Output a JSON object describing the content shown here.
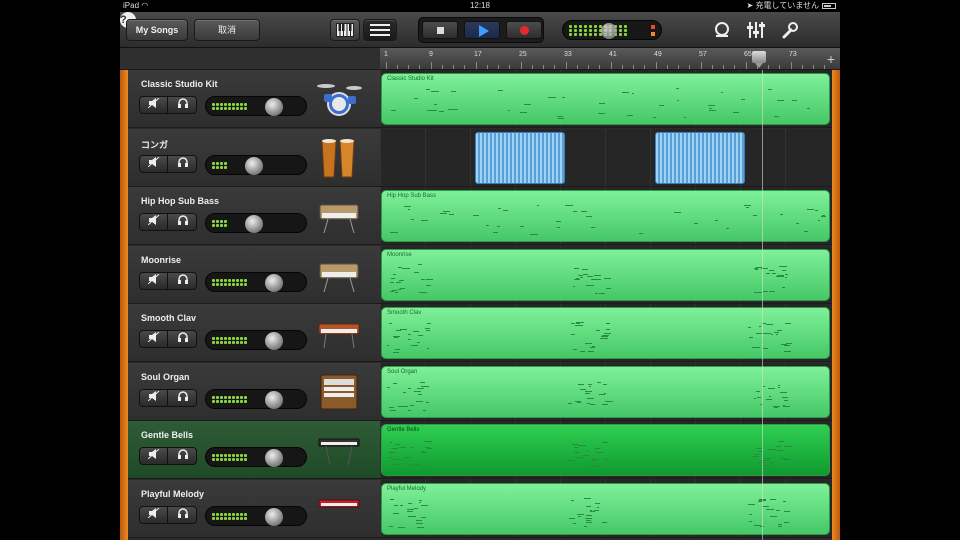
{
  "status_bar": {
    "device": "iPad",
    "wifi_icon": "wifi-icon",
    "time": "12:18",
    "right_text": "充電していません"
  },
  "toolbar": {
    "my_songs": "My Songs",
    "undo": "取消",
    "help": "?"
  },
  "ruler": {
    "marks": [
      "1",
      "9",
      "17",
      "25",
      "33",
      "41",
      "49",
      "57",
      "65",
      "73"
    ],
    "add": "+"
  },
  "tracks": [
    {
      "name": "Classic Studio Kit",
      "region": "Classic Studio Kit",
      "type": "midi",
      "level": 0.62,
      "icon": "drum-kit-icon"
    },
    {
      "name": "コンガ",
      "region": "",
      "type": "audio",
      "level": 0.42,
      "icon": "conga-icon"
    },
    {
      "name": "Hip Hop Sub Bass",
      "region": "Hip Hop Sub Bass",
      "type": "midi",
      "level": 0.42,
      "icon": "synth-keyboard-icon"
    },
    {
      "name": "Moonrise",
      "region": "Moonrise",
      "type": "midi",
      "level": 0.62,
      "icon": "synth-keyboard-icon"
    },
    {
      "name": "Smooth Clav",
      "region": "Smooth Clav",
      "type": "midi",
      "level": 0.62,
      "icon": "clavinet-icon"
    },
    {
      "name": "Soul Organ",
      "region": "Soul Organ",
      "type": "midi",
      "level": 0.62,
      "icon": "organ-icon"
    },
    {
      "name": "Gentle Bells",
      "region": "Gentle Bells",
      "type": "midi",
      "level": 0.62,
      "icon": "keyboard-icon"
    },
    {
      "name": "Playful Melody",
      "region": "Playful Melody",
      "type": "midi",
      "level": 0.62,
      "icon": "red-keyboard-icon"
    }
  ],
  "colors": {
    "region_green": "#45c866",
    "selected_track": "#2e5c36",
    "orange_edge": "#f08a1e",
    "audio_blue": "#5aa0d8"
  }
}
